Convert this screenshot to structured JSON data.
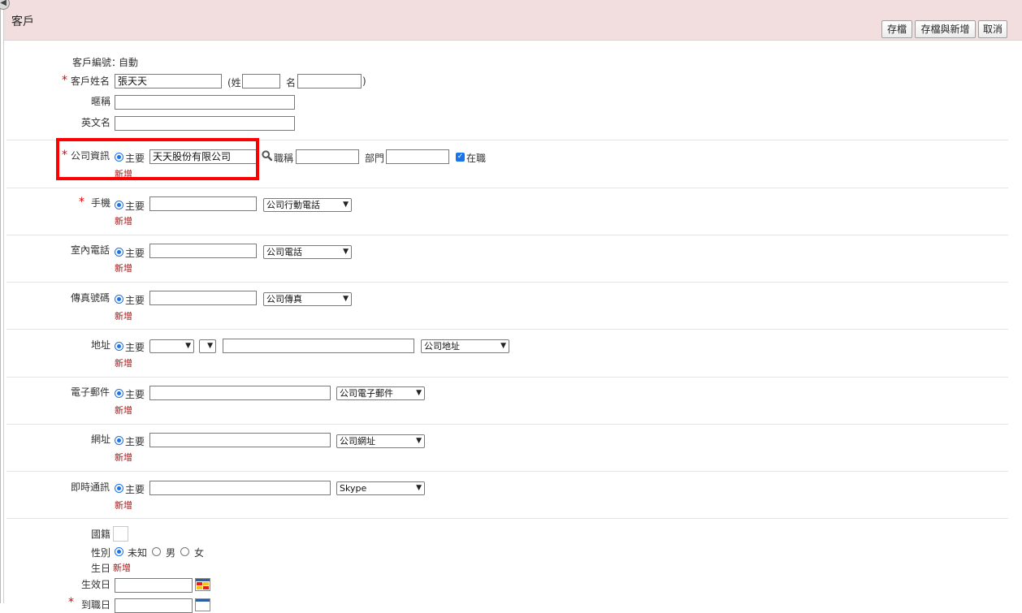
{
  "header": {
    "title": "客戶",
    "buttons": {
      "save": "存檔",
      "save_new": "存檔與新增",
      "cancel": "取消"
    }
  },
  "form": {
    "customer_no": {
      "label": "客戶編號：",
      "value": "自動"
    },
    "customer_name": {
      "label": "客戶姓名",
      "value": "張天天",
      "surname_prefix": "(姓",
      "given_prefix": "名",
      "close_paren": ")"
    },
    "nickname": {
      "label": "暱稱"
    },
    "english_name": {
      "label": "英文名"
    },
    "company": {
      "label": "公司資訊",
      "primary_label": "主要",
      "value": "天天股份有限公司",
      "title_label": "職稱",
      "dept_label": "部門",
      "employed_label": "在職",
      "add_label": "新增"
    },
    "mobile": {
      "label": "手機",
      "primary_label": "主要",
      "type": "公司行動電話",
      "add_label": "新增"
    },
    "phone": {
      "label": "室內電話",
      "primary_label": "主要",
      "type": "公司電話",
      "add_label": "新增"
    },
    "fax": {
      "label": "傳真號碼",
      "primary_label": "主要",
      "type": "公司傳真",
      "add_label": "新增"
    },
    "address": {
      "label": "地址",
      "primary_label": "主要",
      "type": "公司地址",
      "add_label": "新增"
    },
    "email": {
      "label": "電子郵件",
      "primary_label": "主要",
      "type": "公司電子郵件",
      "add_label": "新增"
    },
    "website": {
      "label": "網址",
      "primary_label": "主要",
      "type": "公司網址",
      "add_label": "新增"
    },
    "im": {
      "label": "即時通訊",
      "primary_label": "主要",
      "type": "Skype",
      "add_label": "新增"
    },
    "nationality": {
      "label": "國籍"
    },
    "gender": {
      "label": "性別",
      "options": [
        "未知",
        "男",
        "女"
      ],
      "selected": "未知"
    },
    "birthday": {
      "label": "生日",
      "add_label": "新增"
    },
    "effective_date": {
      "label": "生效日"
    },
    "hire_date": {
      "label": "到職日"
    }
  },
  "colors": {
    "header_bg": "#f2dede",
    "required": "#e00000",
    "add_link": "#a31515",
    "highlight": "#ff0000",
    "accent": "#1a73e8"
  },
  "icons": [
    "collapse-arrow-icon",
    "search-icon",
    "calendar-icon",
    "required-asterisk-icon"
  ]
}
